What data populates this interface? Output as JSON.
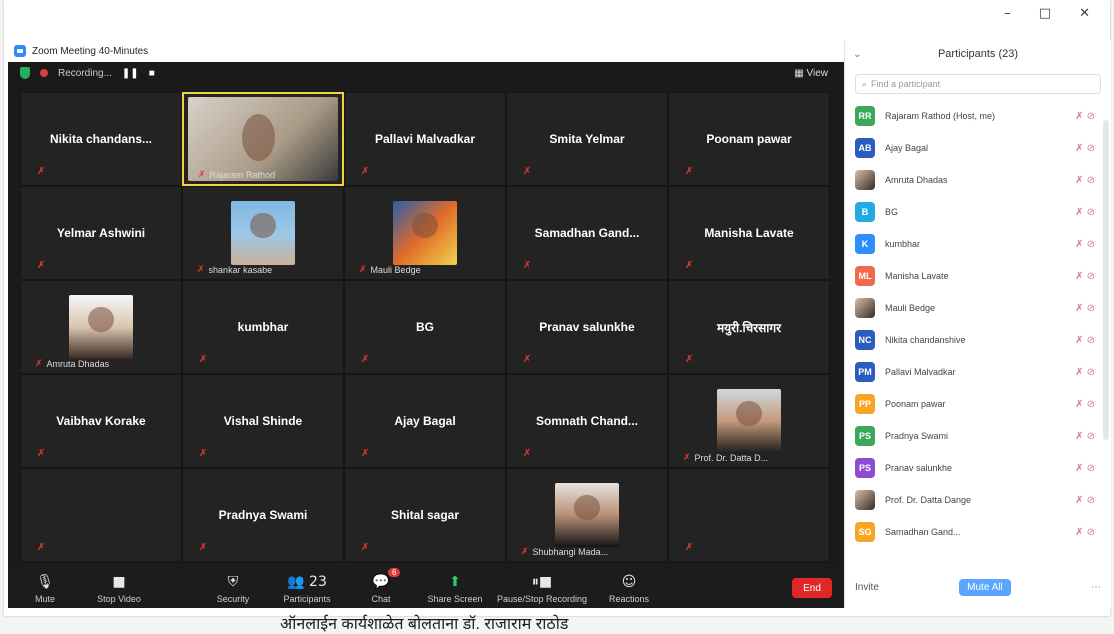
{
  "window": {
    "title": "Zoom Meeting 40-Minutes",
    "controls": {
      "minimize": "–",
      "maximize": "□",
      "close": "✕"
    }
  },
  "meeting": {
    "recording_label": "Recording...",
    "view_label": "View"
  },
  "tiles": [
    {
      "name": "Nikita chandans...",
      "type": "name"
    },
    {
      "name": "Rajaram Rathod",
      "type": "photo",
      "photo": "p1",
      "active": true
    },
    {
      "name": "Pallavi Malvadkar",
      "type": "name"
    },
    {
      "name": "Smita Yelmar",
      "type": "name"
    },
    {
      "name": "Poonam pawar",
      "type": "name"
    },
    {
      "name": "Yelmar Ashwini",
      "type": "name"
    },
    {
      "name": "shankar kasabe",
      "type": "photo",
      "photo": "p2"
    },
    {
      "name": "Mauli Bedge",
      "type": "photo",
      "photo": "p3"
    },
    {
      "name": "Samadhan Gand...",
      "type": "name"
    },
    {
      "name": "Manisha Lavate",
      "type": "name"
    },
    {
      "name": "Amruta Dhadas",
      "type": "photo",
      "photo": "p4"
    },
    {
      "name": "kumbhar",
      "type": "name"
    },
    {
      "name": "BG",
      "type": "name"
    },
    {
      "name": "Pranav salunkhe",
      "type": "name"
    },
    {
      "name": "मयुरी.चिरसागर",
      "type": "name"
    },
    {
      "name": "Vaibhav Korake",
      "type": "name"
    },
    {
      "name": "Vishal Shinde",
      "type": "name"
    },
    {
      "name": "Ajay Bagal",
      "type": "name"
    },
    {
      "name": "Somnath Chand...",
      "type": "name"
    },
    {
      "name": "Prof. Dr. Datta D...",
      "type": "photo",
      "photo": "p5"
    },
    {
      "name": "",
      "type": "empty"
    },
    {
      "name": "Pradnya Swami",
      "type": "name"
    },
    {
      "name": "Shital sagar",
      "type": "name"
    },
    {
      "name": "Shubhangi Mada...",
      "type": "photo",
      "photo": "p6"
    },
    {
      "name": "",
      "type": "empty"
    }
  ],
  "toolbar": {
    "mute": "Mute",
    "stop_video": "Stop Video",
    "security": "Security",
    "participants": "Participants",
    "participants_count": "23",
    "chat": "Chat",
    "chat_badge": "6",
    "share_screen": "Share Screen",
    "pause_stop_recording": "Pause/Stop Recording",
    "reactions": "Reactions",
    "end": "End"
  },
  "panel": {
    "title": "Participants (23)",
    "search_placeholder": "Find a participant",
    "invite": "Invite",
    "mute_all": "Mute All",
    "participants": [
      {
        "initials": "RR",
        "name": "Rajaram Rathod (Host, me)",
        "color": "#3aa757"
      },
      {
        "initials": "AB",
        "name": "Ajay Bagal",
        "color": "#2b5cbf"
      },
      {
        "initials": "",
        "name": "Amruta Dhadas",
        "color": "photo"
      },
      {
        "initials": "B",
        "name": "BG",
        "color": "#23a9e1"
      },
      {
        "initials": "K",
        "name": "kumbhar",
        "color": "#2d8cff"
      },
      {
        "initials": "ML",
        "name": "Manisha Lavate",
        "color": "#f06a4d"
      },
      {
        "initials": "",
        "name": "Mauli Bedge",
        "color": "photo"
      },
      {
        "initials": "NC",
        "name": "Nikita chandanshive",
        "color": "#2b5cbf"
      },
      {
        "initials": "PM",
        "name": "Pallavi Malvadkar",
        "color": "#2b5cbf"
      },
      {
        "initials": "PP",
        "name": "Poonam pawar",
        "color": "#f6a623"
      },
      {
        "initials": "PS",
        "name": "Pradnya Swami",
        "color": "#3aa757"
      },
      {
        "initials": "PS",
        "name": "Pranav salunkhe",
        "color": "#8e4bd1"
      },
      {
        "initials": "",
        "name": "Prof. Dr. Datta Dange",
        "color": "photo"
      },
      {
        "initials": "SG",
        "name": "Samadhan Gand...",
        "color": "#f6a623"
      }
    ]
  },
  "caption": "ऑनलाईन कार्यशाळेत बोलताना डॉ. राजाराम राठोड"
}
